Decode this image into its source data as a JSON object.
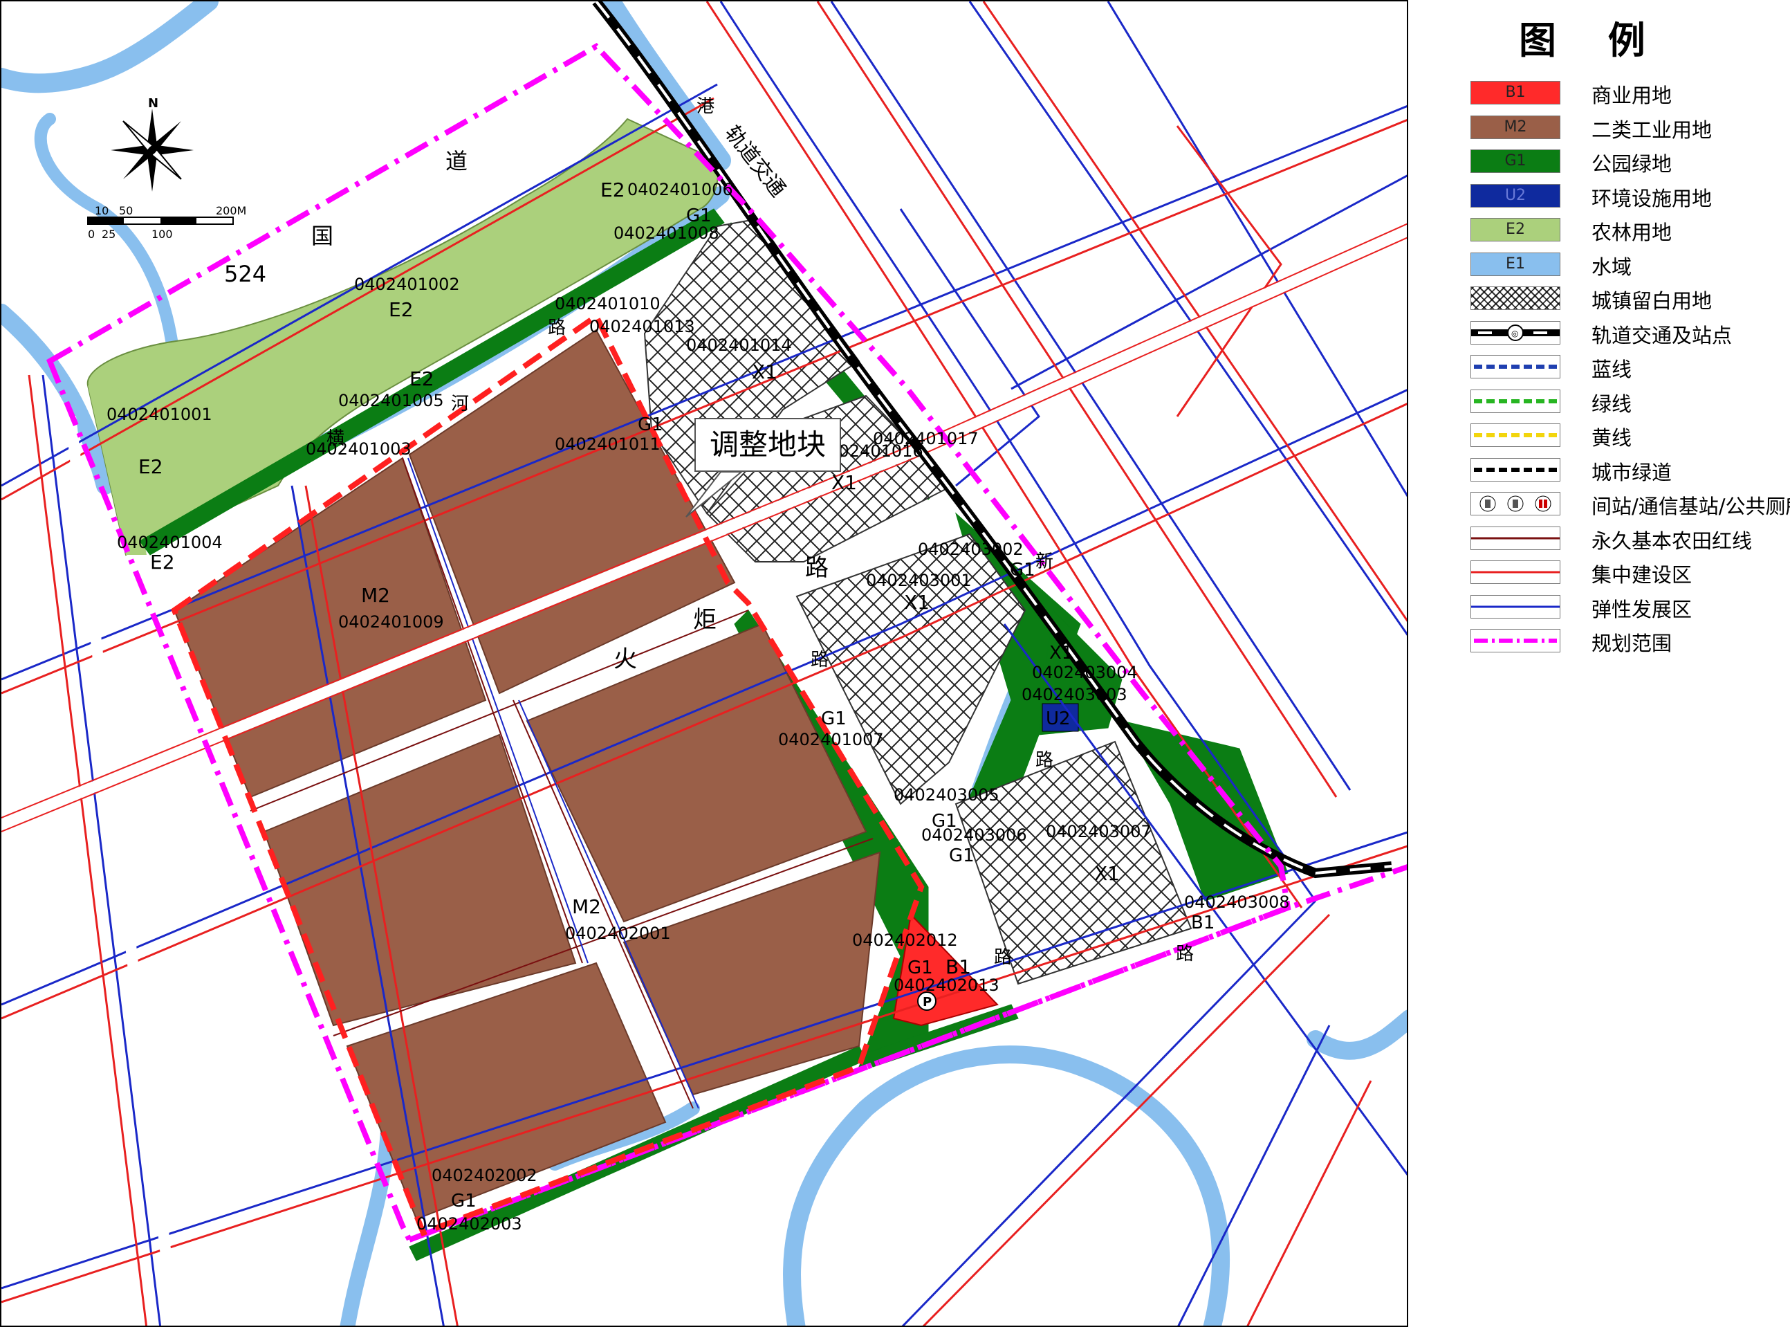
{
  "legend": {
    "title": "图 例",
    "items": [
      {
        "code": "B1",
        "label": "商业用地",
        "color": "#ff2a2a",
        "kind": "fill"
      },
      {
        "code": "M2",
        "label": "二类工业用地",
        "color": "#9a5f48",
        "kind": "fill"
      },
      {
        "code": "G1",
        "label": "公园绿地",
        "color": "#0b7d14",
        "kind": "fill"
      },
      {
        "code": "U2",
        "label": "环境设施用地",
        "color": "#0f2a9e",
        "kind": "fill"
      },
      {
        "code": "E2",
        "label": "农林用地",
        "color": "#abd07c",
        "kind": "fill"
      },
      {
        "code": "E1",
        "label": "水域",
        "color": "#89bfee",
        "kind": "fill"
      },
      {
        "code": "",
        "label": "城镇留白用地",
        "color": "#ffffff",
        "kind": "hatch"
      },
      {
        "code": "",
        "label": "轨道交通及站点",
        "color": "#000000",
        "kind": "rail"
      },
      {
        "code": "",
        "label": "蓝线",
        "color": "#1f3fb0",
        "kind": "dash"
      },
      {
        "code": "",
        "label": "绿线",
        "color": "#27b522",
        "kind": "dash"
      },
      {
        "code": "",
        "label": "黄线",
        "color": "#f2d50c",
        "kind": "dash"
      },
      {
        "code": "",
        "label": "城市绿道",
        "color": "#000000",
        "kind": "dash"
      },
      {
        "code": "",
        "label": "间站/通信基站/公共厕所",
        "color": "#000000",
        "kind": "icons"
      },
      {
        "code": "",
        "label": "永久基本农田红线",
        "color": "#7a1010",
        "kind": "line"
      },
      {
        "code": "",
        "label": "集中建设区",
        "color": "#e82020",
        "kind": "line"
      },
      {
        "code": "",
        "label": "弹性发展区",
        "color": "#1a28c8",
        "kind": "line"
      },
      {
        "code": "",
        "label": "规划范围",
        "color": "#ff00ff",
        "kind": "dashdot"
      }
    ]
  },
  "callout": {
    "text": "调整地块"
  },
  "compass": {
    "north": "N"
  },
  "scale_bar": {
    "top_labels": [
      "10",
      "50",
      "200M"
    ],
    "bottom_labels": [
      "0",
      "25",
      "100"
    ]
  },
  "parcels": [
    {
      "id": "0402401001",
      "code": "E2"
    },
    {
      "id": "0402401002",
      "code": "E2"
    },
    {
      "id": "0402401003",
      "code": ""
    },
    {
      "id": "0402401004",
      "code": "E2"
    },
    {
      "id": "0402401005",
      "code": "E2"
    },
    {
      "id": "0402401006",
      "code": "E2"
    },
    {
      "id": "0402401007",
      "code": "G1"
    },
    {
      "id": "0402401008",
      "code": "G1"
    },
    {
      "id": "0402401009",
      "code": "M2"
    },
    {
      "id": "0402401010",
      "code": ""
    },
    {
      "id": "0402401011",
      "code": ""
    },
    {
      "id": "0402401013",
      "code": ""
    },
    {
      "id": "0402401014",
      "code": "X1"
    },
    {
      "id": "0402401016",
      "code": "X1"
    },
    {
      "id": "0402401017",
      "code": "G1"
    },
    {
      "id": "0402402001",
      "code": "M2"
    },
    {
      "id": "0402402002",
      "code": ""
    },
    {
      "id": "0402402003",
      "code": "G1"
    },
    {
      "id": "0402402012",
      "code": "G1"
    },
    {
      "id": "0402402013",
      "code": "B1"
    },
    {
      "id": "0402403001",
      "code": "X1"
    },
    {
      "id": "0402403002",
      "code": "G1"
    },
    {
      "id": "0402403003",
      "code": "U2"
    },
    {
      "id": "0402403004",
      "code": "X1"
    },
    {
      "id": "0402403005",
      "code": "G1"
    },
    {
      "id": "0402403006",
      "code": "G1"
    },
    {
      "id": "0402403007",
      "code": "X1"
    },
    {
      "id": "0402403008",
      "code": "B1"
    }
  ],
  "map_text": {
    "road_guodao": [
      "国",
      "道",
      "524"
    ],
    "road_huoju": [
      "火",
      "炬",
      "路"
    ],
    "rail_name": "轨道交通",
    "river_name": [
      "横",
      "河"
    ],
    "road_misc": [
      "路",
      "路",
      "路",
      "路",
      "新",
      "路",
      "港"
    ]
  }
}
